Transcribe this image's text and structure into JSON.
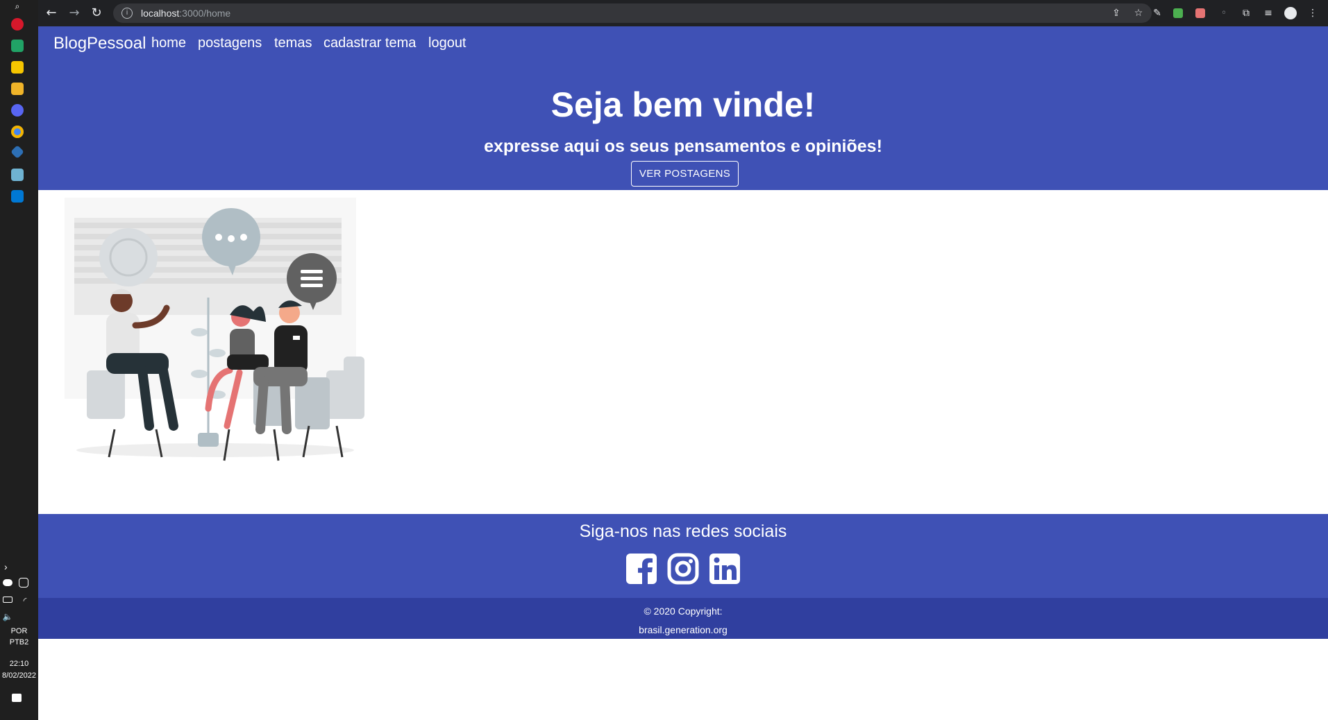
{
  "taskbar": {
    "language": "POR",
    "layout": "PTB2",
    "time": "22:10",
    "date": "8/02/2022"
  },
  "browser": {
    "url_host": "localhost",
    "url_path": ":3000/home"
  },
  "navbar": {
    "brand": "BlogPessoal",
    "links": [
      "home",
      "postagens",
      "temas",
      "cadastrar tema",
      "logout"
    ]
  },
  "hero": {
    "title": "Seja bem vinde!",
    "subtitle": "expresse aqui os seus pensamentos e opiniões!",
    "button": "VER POSTAGENS"
  },
  "footer": {
    "social_title": "Siga-nos nas redes sociais",
    "social_icons": [
      "facebook-icon",
      "instagram-icon",
      "linkedin-icon"
    ],
    "copyright": "© 2020 Copyright:",
    "site": "brasil.generation.org"
  },
  "colors": {
    "primary": "#3f51b5",
    "primary_dark": "#303f9f"
  }
}
